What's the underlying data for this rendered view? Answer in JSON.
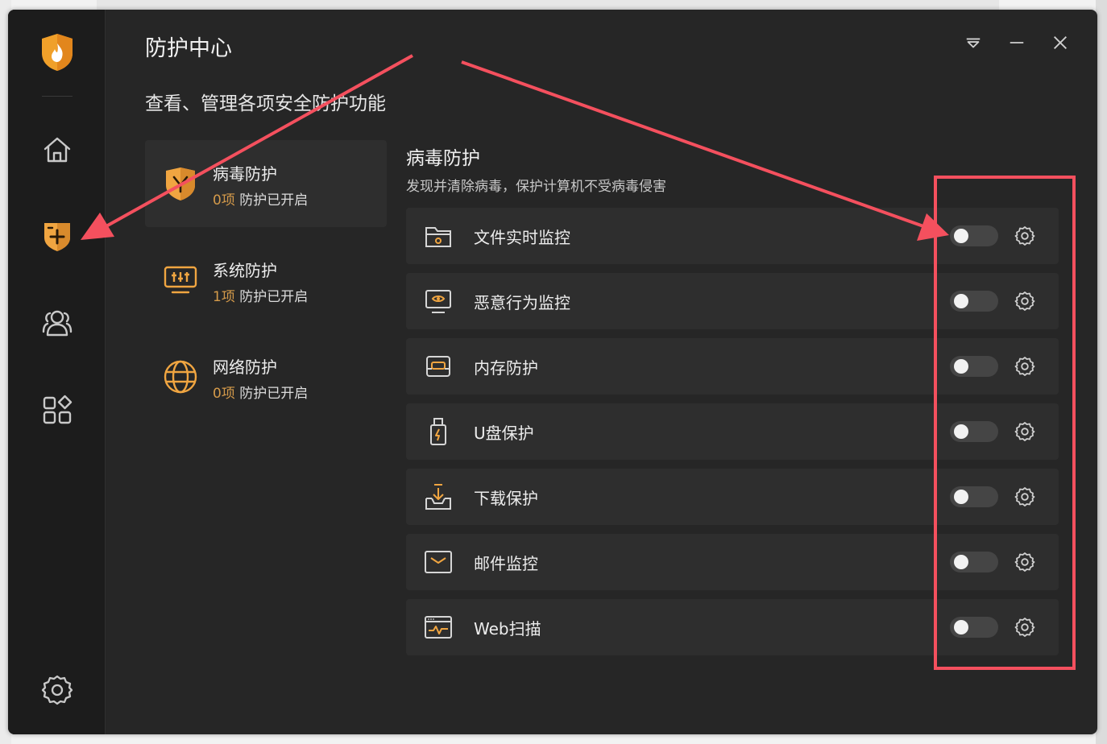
{
  "colors": {
    "accent": "#f0a541",
    "window_bg": "#262626",
    "sidebar_bg": "#1c1c1c",
    "card_bg": "#2e2e2e",
    "annotation": "#f4505e"
  },
  "sidebar": {
    "items": [
      {
        "icon": "home-icon"
      },
      {
        "icon": "shield-plus-icon",
        "active": true
      },
      {
        "icon": "users-icon"
      },
      {
        "icon": "apps-icon"
      },
      {
        "icon": "gear-icon"
      }
    ]
  },
  "header": {
    "title": "防护中心",
    "subtitle": "查看、管理各项安全防护功能"
  },
  "window_controls": [
    "menu-icon",
    "minimize-icon",
    "close-icon"
  ],
  "categories": [
    {
      "name": "病毒防护",
      "count": "0项",
      "status": "防护已开启",
      "icon": "virus-shield-icon",
      "active": true
    },
    {
      "name": "系统防护",
      "count": "1项",
      "status": "防护已开启",
      "icon": "system-monitor-icon"
    },
    {
      "name": "网络防护",
      "count": "0项",
      "status": "防护已开启",
      "icon": "globe-icon"
    }
  ],
  "section": {
    "title": "病毒防护",
    "description": "发现并清除病毒，保护计算机不受病毒侵害",
    "items": [
      {
        "label": "文件实时监控",
        "icon": "folder-icon",
        "enabled": false
      },
      {
        "label": "恶意行为监控",
        "icon": "monitor-eye-icon",
        "enabled": false
      },
      {
        "label": "内存防护",
        "icon": "memory-icon",
        "enabled": false
      },
      {
        "label": "U盘保护",
        "icon": "usb-icon",
        "enabled": false
      },
      {
        "label": "下载保护",
        "icon": "download-icon",
        "enabled": false
      },
      {
        "label": "邮件监控",
        "icon": "mail-icon",
        "enabled": false
      },
      {
        "label": "Web扫描",
        "icon": "web-scan-icon",
        "enabled": false
      }
    ]
  }
}
